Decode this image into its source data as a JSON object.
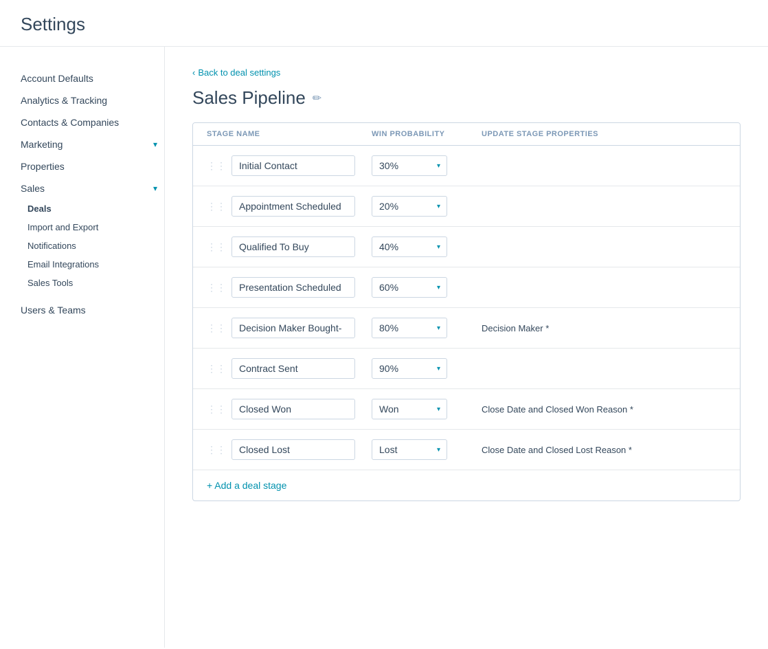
{
  "app": {
    "title": "Settings"
  },
  "sidebar": {
    "items": [
      {
        "id": "account-defaults",
        "label": "Account Defaults",
        "active": false,
        "hasChildren": false
      },
      {
        "id": "analytics-tracking",
        "label": "Analytics & Tracking",
        "active": false,
        "hasChildren": false
      },
      {
        "id": "contacts-companies",
        "label": "Contacts & Companies",
        "active": false,
        "hasChildren": false
      },
      {
        "id": "marketing",
        "label": "Marketing",
        "active": false,
        "hasChildren": true,
        "expanded": true
      },
      {
        "id": "properties",
        "label": "Properties",
        "active": false,
        "hasChildren": false
      },
      {
        "id": "sales",
        "label": "Sales",
        "active": false,
        "hasChildren": true,
        "expanded": true
      }
    ],
    "sub_items": [
      {
        "id": "deals",
        "label": "Deals",
        "active": true
      },
      {
        "id": "import-export",
        "label": "Import and Export",
        "active": false
      },
      {
        "id": "notifications",
        "label": "Notifications",
        "active": false
      },
      {
        "id": "email-integrations",
        "label": "Email Integrations",
        "active": false
      },
      {
        "id": "sales-tools",
        "label": "Sales Tools",
        "active": false
      }
    ],
    "bottom_items": [
      {
        "id": "users-teams",
        "label": "Users & Teams",
        "active": false
      }
    ]
  },
  "header": {
    "back_link": "Back to deal settings",
    "page_title": "Sales Pipeline",
    "edit_icon": "✏"
  },
  "table": {
    "columns": [
      {
        "id": "stage-name",
        "label": "STAGE NAME"
      },
      {
        "id": "win-probability",
        "label": "WIN PROBABILITY"
      },
      {
        "id": "update-stage-props",
        "label": "UPDATE STAGE PROPERTIES"
      }
    ],
    "rows": [
      {
        "id": "initial-contact",
        "stage_name": "Initial Contact",
        "probability": "30%",
        "properties": ""
      },
      {
        "id": "appointment-scheduled",
        "stage_name": "Appointment Scheduled",
        "probability": "20%",
        "properties": ""
      },
      {
        "id": "qualified-to-buy",
        "stage_name": "Qualified To Buy",
        "probability": "40%",
        "properties": ""
      },
      {
        "id": "presentation-scheduled",
        "stage_name": "Presentation Scheduled",
        "probability": "60%",
        "properties": ""
      },
      {
        "id": "decision-maker-bought",
        "stage_name": "Decision Maker Bought-",
        "probability": "80%",
        "properties": "Decision Maker *"
      },
      {
        "id": "contract-sent",
        "stage_name": "Contract Sent",
        "probability": "90%",
        "properties": ""
      },
      {
        "id": "closed-won",
        "stage_name": "Closed Won",
        "probability": "Won",
        "properties": "Close Date and Closed Won Reason *"
      },
      {
        "id": "closed-lost",
        "stage_name": "Closed Lost",
        "probability": "Lost",
        "properties": "Close Date and Closed Lost Reason *"
      }
    ],
    "add_stage_label": "+ Add a deal stage"
  }
}
